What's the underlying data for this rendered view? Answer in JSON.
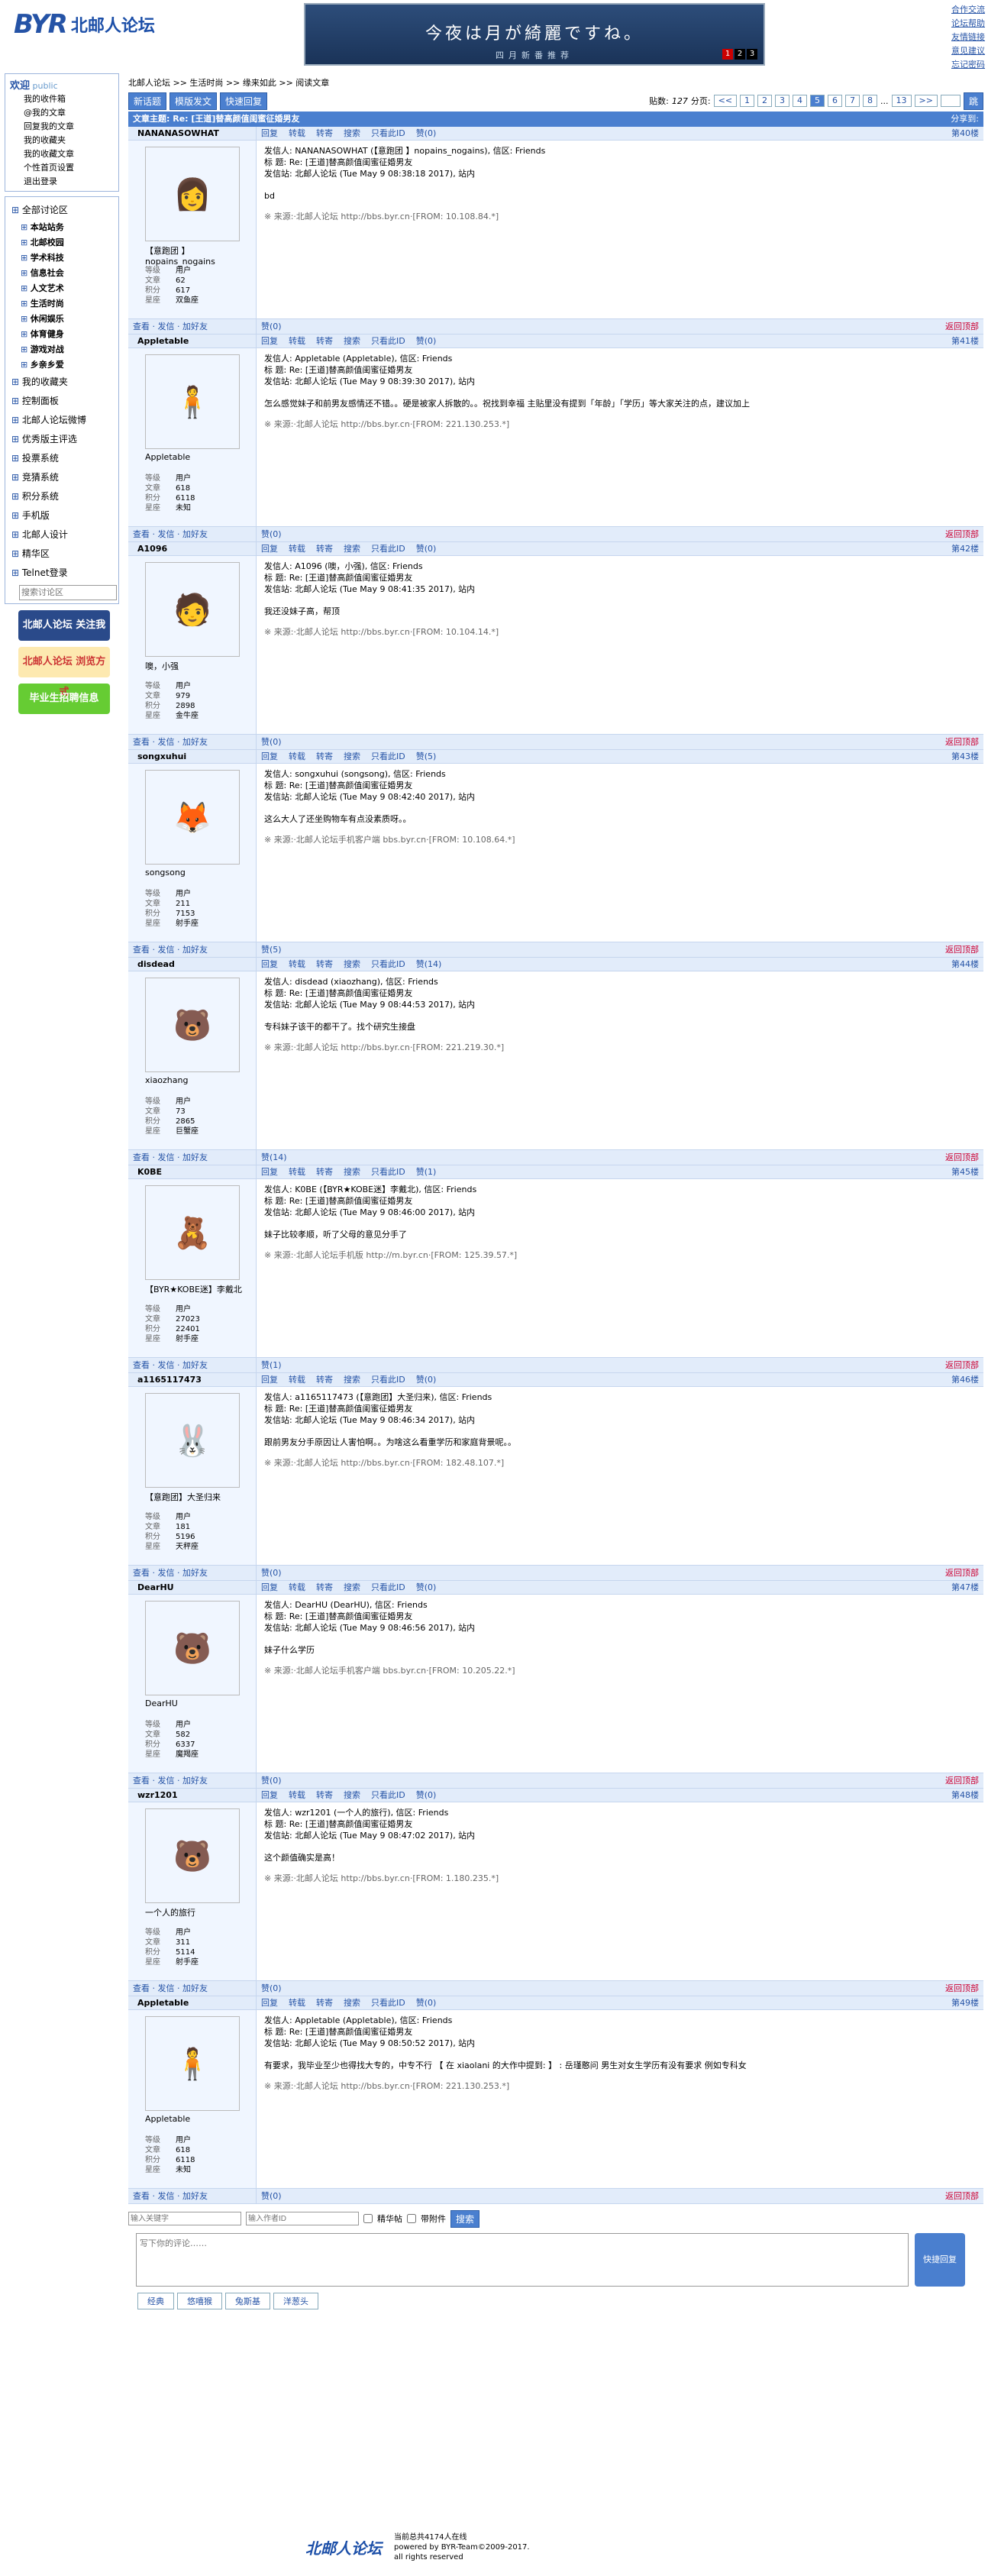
{
  "header": {
    "logo_text": "北邮人论坛",
    "banner_line1": "今夜は月が綺麗ですね。",
    "banner_line2": "四月新番推荐",
    "banner_nums": [
      "1",
      "2",
      "3"
    ],
    "top_links": [
      "合作交流",
      "论坛帮助",
      "友情链接",
      "意见建议",
      "忘记密码"
    ]
  },
  "sidebar": {
    "welcome": "欢迎",
    "public": "public",
    "user_links": [
      "我的收件箱",
      "@我的文章",
      "回复我的文章",
      "我的收藏夹",
      "我的收藏文章",
      "个性首页设置",
      "退出登录"
    ],
    "all_boards": "全部讨论区",
    "sections": [
      "本站站务",
      "北邮校园",
      "学术科技",
      "信息社会",
      "人文艺术",
      "生活时尚",
      "休闲娱乐",
      "体育健身",
      "游戏对战",
      "乡亲乡爱"
    ],
    "nav": [
      "我的收藏夹",
      "控制面板",
      "北邮人论坛微博",
      "优秀版主评选",
      "投票系统",
      "竞猜系统",
      "积分系统",
      "手机版",
      "北邮人设计",
      "精华区",
      "Telnet登录"
    ],
    "search_placeholder": "搜索讨论区",
    "ad1": "北邮人论坛 关注我",
    "ad2": "北邮人论坛 浏览方式",
    "ad3": "毕业生招聘信息"
  },
  "crumb": "北邮人论坛 >> 生活时尚 >> 缘来如此 >> 阅读文章",
  "buttons": {
    "new": "新话题",
    "tpl": "模版发文",
    "quick": "快速回复"
  },
  "pager": {
    "label_posts": "贴数:",
    "posts": "127",
    "label_pages": "分页:",
    "pages": [
      "<<",
      "1",
      "2",
      "3",
      "4",
      "5",
      "6",
      "7",
      "8",
      "...",
      "13",
      ">>"
    ],
    "current": "5",
    "go": "跳"
  },
  "topic": {
    "title": "文章主题: Re: [王道]替高颜值闺蜜征婚男友",
    "share": "分享到:"
  },
  "tools": [
    "回复",
    "转载",
    "转寄",
    "搜索",
    "只看此ID",
    "赞"
  ],
  "posts": [
    {
      "user": "NANANASOWHAT",
      "floor": "第40楼",
      "avatar": "👩",
      "nick": "【意跑团 】nopains_nogains",
      "level": "用户",
      "articles": "62",
      "score": "617",
      "star": "双鱼座",
      "likes": "赞(0)",
      "from": "发信人: NANANASOWHAT (【意跑团 】nopains_nogains), 信区: Friends",
      "title": "标  题: Re: [王道]替高颜值闺蜜征婚男友",
      "site": "发信站: 北邮人论坛 (Tue May  9 08:38:18 2017), 站内",
      "text": "bd",
      "src": "※ 来源:·北邮人论坛 http://bbs.byr.cn·[FROM: 10.108.84.*]",
      "like2": "赞(0)"
    },
    {
      "user": "Appletable",
      "floor": "第41楼",
      "avatar": "🧍",
      "nick": "Appletable",
      "level": "用户",
      "articles": "618",
      "score": "6118",
      "star": "未知",
      "likes": "赞(0)",
      "from": "发信人: Appletable (Appletable), 信区: Friends",
      "title": "标  题: Re: [王道]替高颜值闺蜜征婚男友",
      "site": "发信站: 北邮人论坛 (Tue May  9 08:39:30 2017), 站内",
      "text": "怎么感觉妹子和前男友感情还不错。。硬是被家人拆散的。。祝找到幸福 主贴里没有提到「年龄」「学历」等大家关注的点，建议加上",
      "src": "※ 来源:·北邮人论坛 http://bbs.byr.cn·[FROM: 221.130.253.*]",
      "like2": "赞(0)"
    },
    {
      "user": "A1096",
      "floor": "第42楼",
      "avatar": "🧑",
      "nick": "噢，小强",
      "level": "用户",
      "articles": "979",
      "score": "2898",
      "star": "金牛座",
      "likes": "赞(0)",
      "from": "发信人: A1096 (噢，小强), 信区: Friends",
      "title": "标  题: Re: [王道]替高颜值闺蜜征婚男友",
      "site": "发信站: 北邮人论坛 (Tue May  9 08:41:35 2017), 站内",
      "text": "我还没妹子高，帮顶",
      "src": "※ 来源:·北邮人论坛 http://bbs.byr.cn·[FROM: 10.104.14.*]",
      "like2": "赞(0)"
    },
    {
      "user": "songxuhui",
      "floor": "第43楼",
      "avatar": "🦊",
      "nick": "songsong",
      "level": "用户",
      "articles": "211",
      "score": "7153",
      "star": "射手座",
      "likes": "赞(5)",
      "from": "发信人: songxuhui (songsong), 信区: Friends",
      "title": "标  题: Re: [王道]替高颜值闺蜜征婚男友",
      "site": "发信站: 北邮人论坛 (Tue May  9 08:42:40 2017), 站内",
      "text": "这么大人了还坐购物车有点没素质呀。。",
      "src": "※ 来源:·北邮人论坛手机客户端 bbs.byr.cn·[FROM: 10.108.64.*]",
      "like2": "赞(5)"
    },
    {
      "user": "disdead",
      "floor": "第44楼",
      "avatar": "🐻",
      "nick": "xiaozhang",
      "level": "用户",
      "articles": "73",
      "score": "2865",
      "star": "巨蟹座",
      "likes": "赞(14)",
      "from": "发信人: disdead (xiaozhang), 信区: Friends",
      "title": "标  题: Re: [王道]替高颜值闺蜜征婚男友",
      "site": "发信站: 北邮人论坛 (Tue May  9 08:44:53 2017), 站内",
      "text": "专科妹子该干的都干了。找个研究生接盘",
      "src": "※ 来源:·北邮人论坛 http://bbs.byr.cn·[FROM: 221.219.30.*]",
      "like2": "赞(14)"
    },
    {
      "user": "K0BE",
      "floor": "第45楼",
      "avatar": "🧸",
      "nick": "【BYR★KOBE迷】李戴北",
      "level": "用户",
      "articles": "27023",
      "score": "22401",
      "star": "射手座",
      "likes": "赞(1)",
      "from": "发信人: K0BE (【BYR★KOBE迷】李戴北), 信区: Friends",
      "title": "标  题: Re: [王道]替高颜值闺蜜征婚男友",
      "site": "发信站: 北邮人论坛 (Tue May  9 08:46:00 2017), 站内",
      "text": "妹子比较孝顺，听了父母的意见分手了",
      "src": "※ 来源:·北邮人论坛手机版 http://m.byr.cn·[FROM: 125.39.57.*]",
      "like2": "赞(1)"
    },
    {
      "user": "a1165117473",
      "floor": "第46楼",
      "avatar": "🐰",
      "nick": "【意跑团】大圣归来",
      "level": "用户",
      "articles": "181",
      "score": "5196",
      "star": "天秤座",
      "likes": "赞(0)",
      "from": "发信人: a1165117473 (【意跑团】大圣归来), 信区: Friends",
      "title": "标  题: Re: [王道]替高颜值闺蜜征婚男友",
      "site": "发信站: 北邮人论坛 (Tue May  9 08:46:34 2017), 站内",
      "text": "跟前男友分手原因让人害怕啊。。为啥这么看重学历和家庭背景呢。。",
      "src": "※ 来源:·北邮人论坛 http://bbs.byr.cn·[FROM: 182.48.107.*]",
      "like2": "赞(0)"
    },
    {
      "user": "DearHU",
      "floor": "第47楼",
      "avatar": "🐻",
      "nick": "DearHU",
      "level": "用户",
      "articles": "582",
      "score": "6337",
      "star": "魔羯座",
      "likes": "赞(0)",
      "from": "发信人: DearHU (DearHU), 信区: Friends",
      "title": "标  题: Re: [王道]替高颜值闺蜜征婚男友",
      "site": "发信站: 北邮人论坛 (Tue May  9 08:46:56 2017), 站内",
      "text": "妹子什么学历",
      "src": "※ 来源:·北邮人论坛手机客户端 bbs.byr.cn·[FROM: 10.205.22.*]",
      "like2": "赞(0)"
    },
    {
      "user": "wzr1201",
      "floor": "第48楼",
      "avatar": "🐻",
      "nick": "一个人的旅行",
      "level": "用户",
      "articles": "311",
      "score": "5114",
      "star": "射手座",
      "likes": "赞(0)",
      "from": "发信人: wzr1201 (一个人的旅行), 信区: Friends",
      "title": "标  题: Re: [王道]替高颜值闺蜜征婚男友",
      "site": "发信站: 北邮人论坛 (Tue May  9 08:47:02 2017), 站内",
      "text": "这个颜值确实是高！",
      "src": "※ 来源:·北邮人论坛 http://bbs.byr.cn·[FROM: 1.180.235.*]",
      "like2": "赞(0)"
    },
    {
      "user": "Appletable",
      "floor": "第49楼",
      "avatar": "🧍",
      "nick": "Appletable",
      "level": "用户",
      "articles": "618",
      "score": "6118",
      "star": "未知",
      "likes": "赞(0)",
      "from": "发信人: Appletable (Appletable), 信区: Friends",
      "title": "标  题: Re: [王道]替高颜值闺蜜征婚男友",
      "site": "发信站: 北邮人论坛 (Tue May  9 08:50:52 2017), 站内",
      "text": "有要求，我毕业至少也得找大专的，中专不行 【 在 xiaolani 的大作中提到: 】 : 岳瑾憨问 男生对女生学历有没有要求 例如专科女",
      "src": "※ 来源:·北邮人论坛 http://bbs.byr.cn·[FROM: 221.130.253.*]",
      "like2": "赞(0)"
    }
  ],
  "ulinks": {
    "view": "查看",
    "msg": "发信",
    "add": "加好友"
  },
  "labels": {
    "level": "等级",
    "articles": "文章",
    "score": "积分",
    "star": "星座",
    "top": "返回顶部"
  },
  "bottom": {
    "kw": "输入关键字",
    "author": "输入作者ID",
    "elite": "精华帖",
    "attach": "带附件",
    "search": "搜索"
  },
  "reply": {
    "placeholder": "写下你的评论……",
    "submit": "快捷回复",
    "tabs": [
      "经典",
      "悠嘻猴",
      "兔斯基",
      "洋葱头"
    ]
  },
  "footer": {
    "logo": "北邮人论坛",
    "online": "当前总共4174人在线",
    "powered": "powered by BYR-Team©2009-2017.",
    "rights": "all rights reserved"
  }
}
